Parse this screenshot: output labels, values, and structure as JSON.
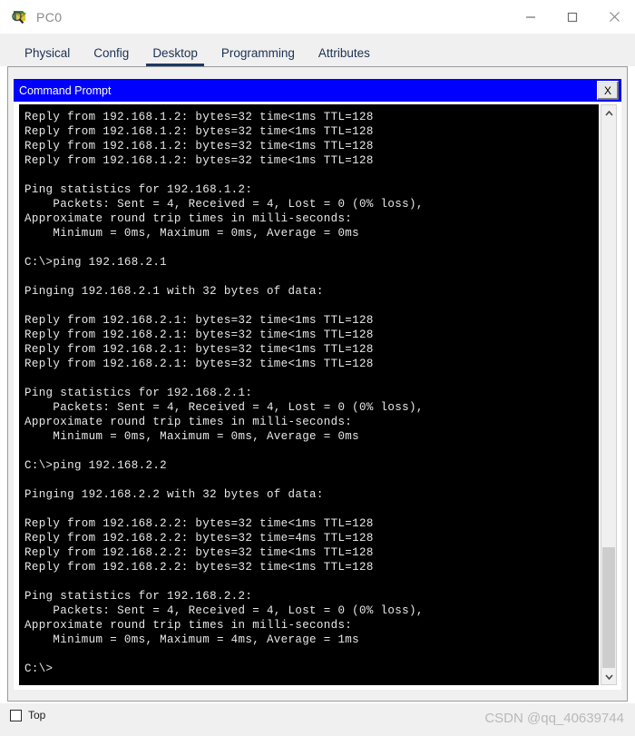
{
  "window": {
    "title": "PC0",
    "icon": "packet-tracer-pc-icon",
    "controls": {
      "minimize": "minimize-icon",
      "maximize": "maximize-icon",
      "close": "close-icon"
    }
  },
  "tabs": [
    {
      "label": "Physical",
      "active": false
    },
    {
      "label": "Config",
      "active": false
    },
    {
      "label": "Desktop",
      "active": true
    },
    {
      "label": "Programming",
      "active": false
    },
    {
      "label": "Attributes",
      "active": false
    }
  ],
  "command_prompt": {
    "title": "Command Prompt",
    "close_label": "X",
    "scrollbar": {
      "up_arrow": "chevron-up-icon",
      "down_arrow": "chevron-down-icon"
    },
    "lines": [
      "Reply from 192.168.1.2: bytes=32 time<1ms TTL=128",
      "Reply from 192.168.1.2: bytes=32 time<1ms TTL=128",
      "Reply from 192.168.1.2: bytes=32 time<1ms TTL=128",
      "Reply from 192.168.1.2: bytes=32 time<1ms TTL=128",
      "",
      "Ping statistics for 192.168.1.2:",
      "    Packets: Sent = 4, Received = 4, Lost = 0 (0% loss),",
      "Approximate round trip times in milli-seconds:",
      "    Minimum = 0ms, Maximum = 0ms, Average = 0ms",
      "",
      "C:\\>ping 192.168.2.1",
      "",
      "Pinging 192.168.2.1 with 32 bytes of data:",
      "",
      "Reply from 192.168.2.1: bytes=32 time<1ms TTL=128",
      "Reply from 192.168.2.1: bytes=32 time<1ms TTL=128",
      "Reply from 192.168.2.1: bytes=32 time<1ms TTL=128",
      "Reply from 192.168.2.1: bytes=32 time<1ms TTL=128",
      "",
      "Ping statistics for 192.168.2.1:",
      "    Packets: Sent = 4, Received = 4, Lost = 0 (0% loss),",
      "Approximate round trip times in milli-seconds:",
      "    Minimum = 0ms, Maximum = 0ms, Average = 0ms",
      "",
      "C:\\>ping 192.168.2.2",
      "",
      "Pinging 192.168.2.2 with 32 bytes of data:",
      "",
      "Reply from 192.168.2.2: bytes=32 time<1ms TTL=128",
      "Reply from 192.168.2.2: bytes=32 time=4ms TTL=128",
      "Reply from 192.168.2.2: bytes=32 time<1ms TTL=128",
      "Reply from 192.168.2.2: bytes=32 time<1ms TTL=128",
      "",
      "Ping statistics for 192.168.2.2:",
      "    Packets: Sent = 4, Received = 4, Lost = 0 (0% loss),",
      "Approximate round trip times in milli-seconds:",
      "    Minimum = 0ms, Maximum = 4ms, Average = 1ms",
      "",
      "C:\\>"
    ]
  },
  "footer": {
    "top_checkbox": {
      "label": "Top",
      "checked": false
    },
    "watermark": "CSDN @qq_40639744"
  },
  "colors": {
    "cmd_titlebar": "#0000ff",
    "terminal_bg": "#000000",
    "terminal_fg": "#e8e8e8",
    "tab_active_underline": "#1b3a63",
    "panel_bg": "#f0f0f0"
  }
}
